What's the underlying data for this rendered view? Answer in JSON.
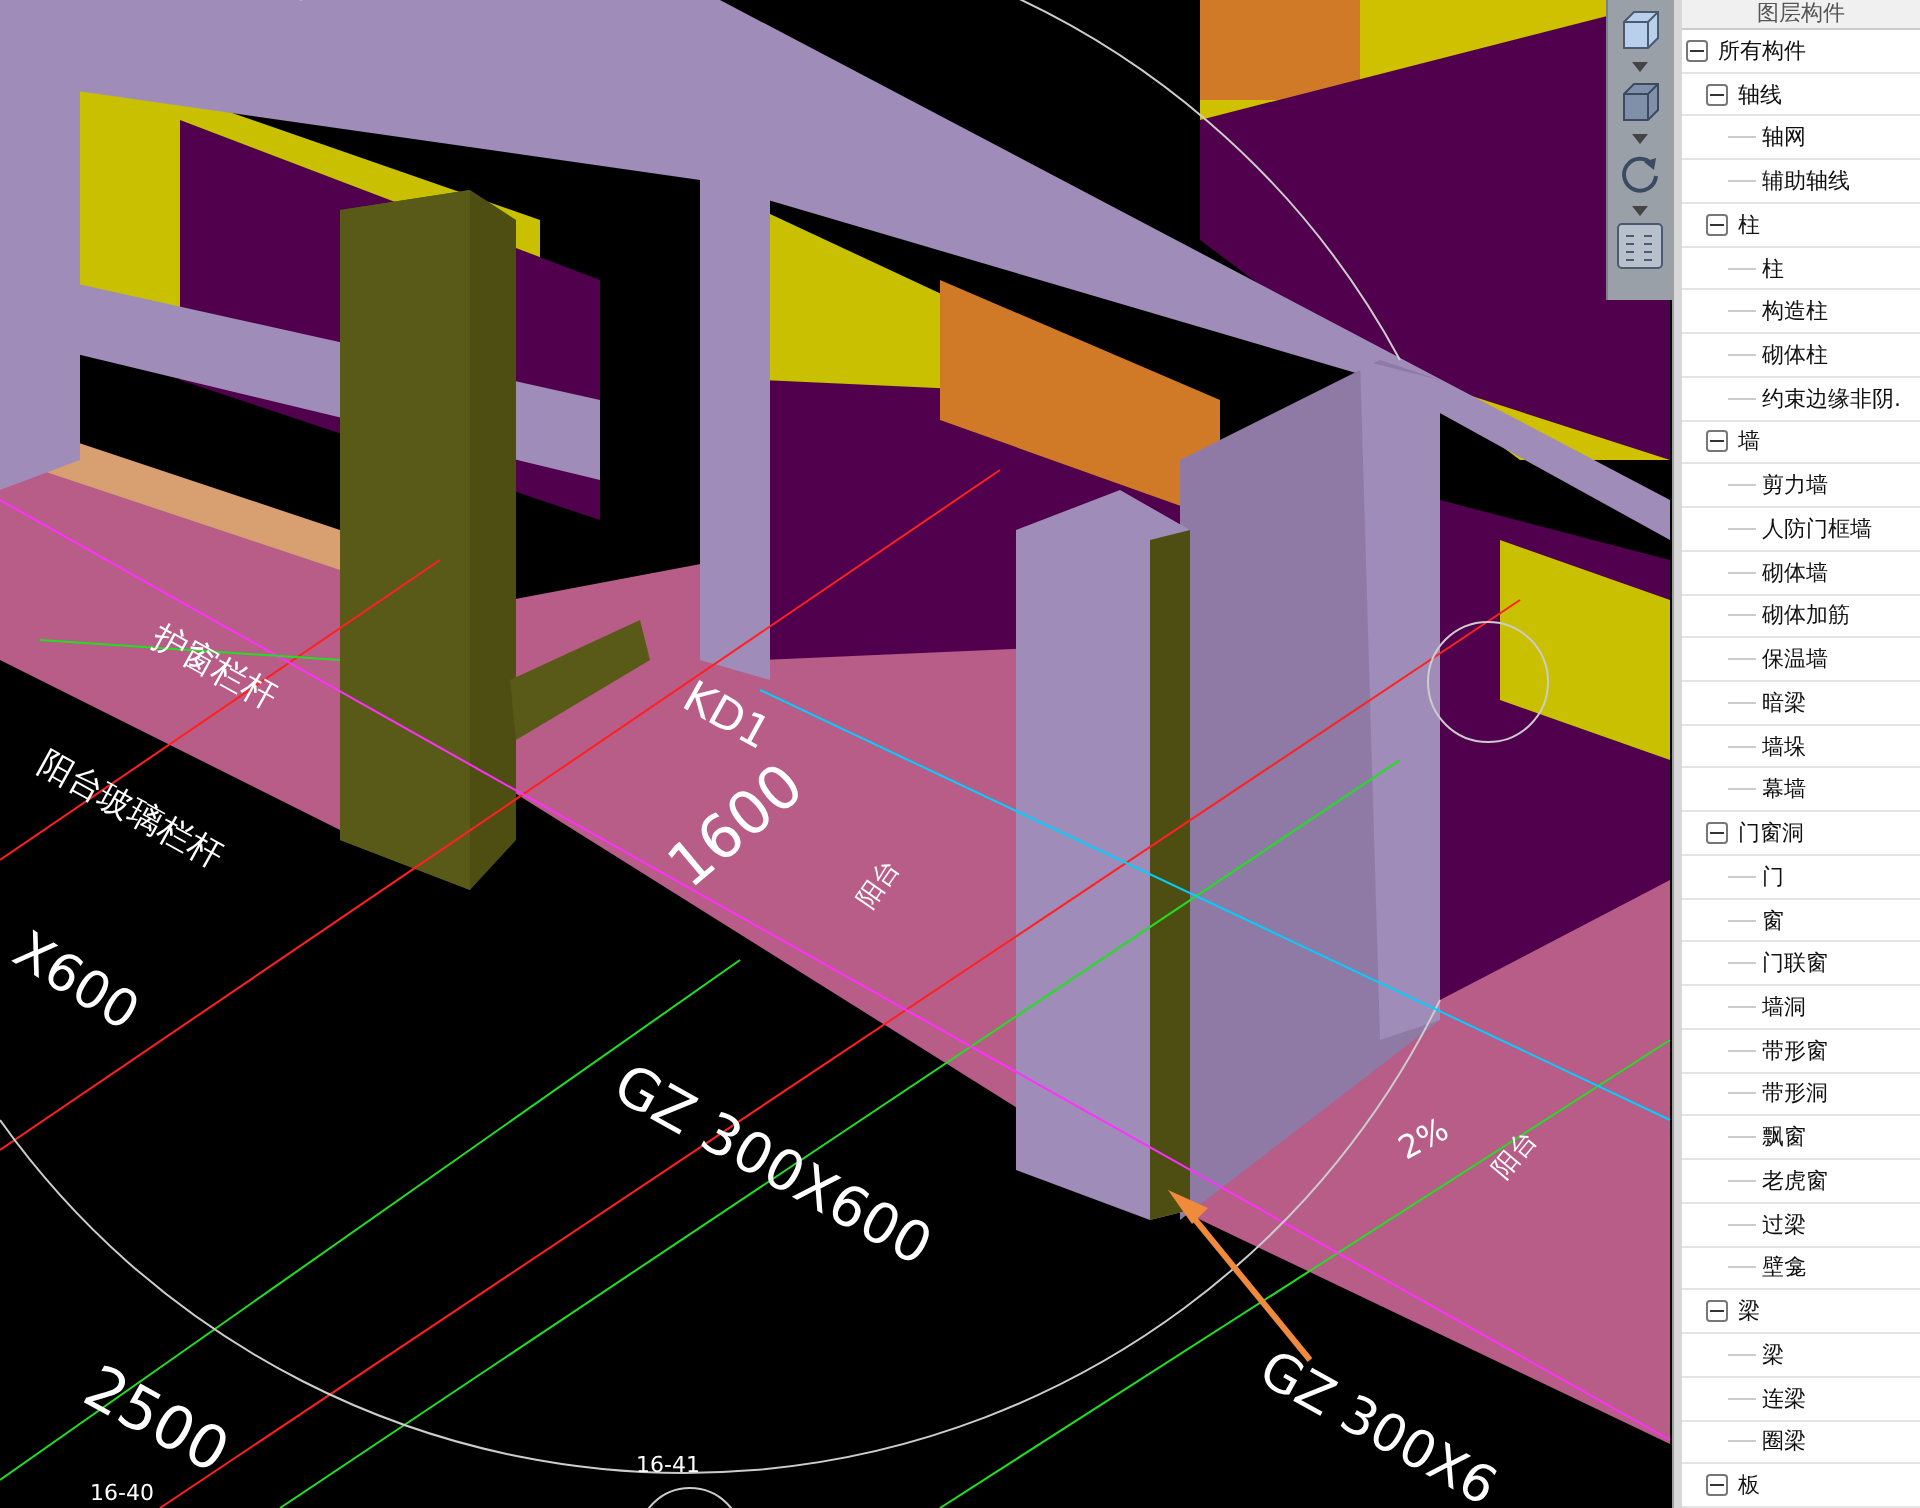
{
  "viewport": {
    "labels": [
      "护窗栏杆",
      "阳台玻璃栏杆",
      "X600",
      "KD1",
      "1600",
      "阳台",
      "GZ 300X600",
      "2500",
      "16-40",
      "16-41",
      "2%",
      "阳台",
      "GZ 300X6"
    ]
  },
  "panel": {
    "title": "图层构件",
    "tree": [
      {
        "label": "所有构件",
        "expanded": true,
        "children": [
          {
            "label": "轴线",
            "expanded": true,
            "children": [
              {
                "label": "轴网"
              },
              {
                "label": "辅助轴线"
              }
            ]
          },
          {
            "label": "柱",
            "expanded": true,
            "children": [
              {
                "label": "柱"
              },
              {
                "label": "构造柱"
              },
              {
                "label": "砌体柱"
              },
              {
                "label": "约束边缘非阴."
              }
            ]
          },
          {
            "label": "墙",
            "expanded": true,
            "children": [
              {
                "label": "剪力墙"
              },
              {
                "label": "人防门框墙"
              },
              {
                "label": "砌体墙"
              },
              {
                "label": "砌体加筋"
              },
              {
                "label": "保温墙"
              },
              {
                "label": "暗梁"
              },
              {
                "label": "墙垛"
              },
              {
                "label": "幕墙"
              }
            ]
          },
          {
            "label": "门窗洞",
            "expanded": true,
            "children": [
              {
                "label": "门"
              },
              {
                "label": "窗"
              },
              {
                "label": "门联窗"
              },
              {
                "label": "墙洞"
              },
              {
                "label": "带形窗"
              },
              {
                "label": "带形洞"
              },
              {
                "label": "飘窗"
              },
              {
                "label": "老虎窗"
              },
              {
                "label": "过梁"
              },
              {
                "label": "壁龛"
              }
            ]
          },
          {
            "label": "梁",
            "expanded": true,
            "children": [
              {
                "label": "梁"
              },
              {
                "label": "连梁"
              },
              {
                "label": "圈梁"
              }
            ]
          },
          {
            "label": "板",
            "expanded": true
          }
        ]
      }
    ]
  }
}
